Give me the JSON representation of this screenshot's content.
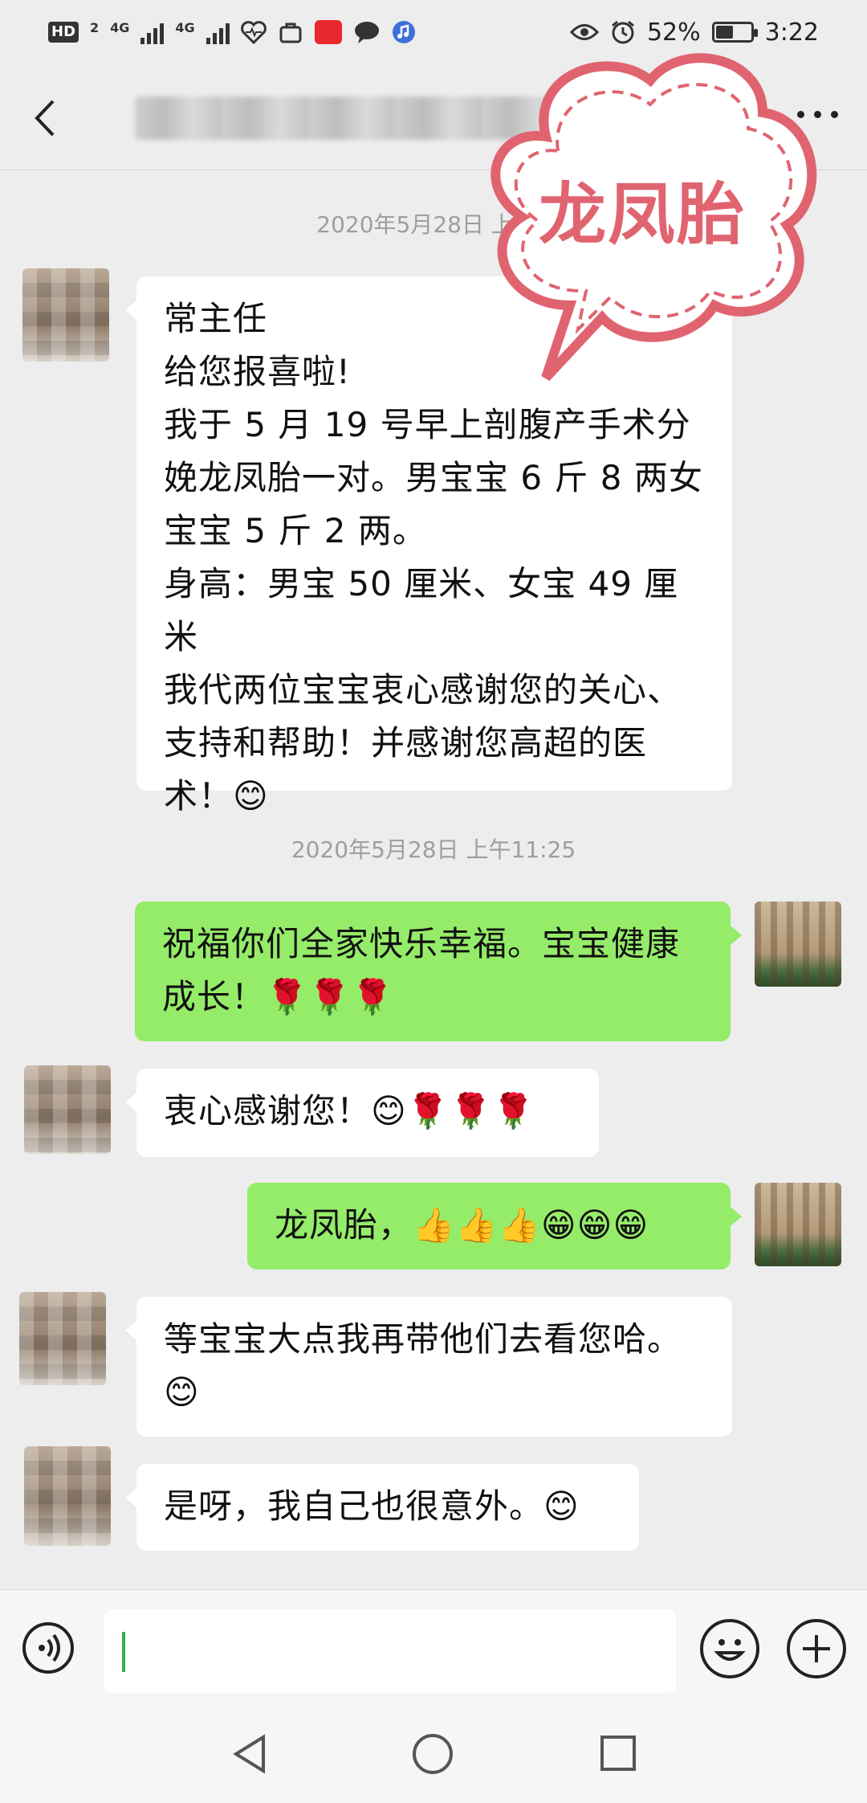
{
  "status_bar": {
    "left_badges": [
      "HD",
      "2"
    ],
    "network_1": "4G",
    "network_2": "4G",
    "battery_percent": "52%",
    "battery_level": 0.52,
    "time": "3:22",
    "icons": [
      "hd-icon",
      "signal-icon",
      "signal-icon",
      "heart-pulse-icon",
      "bag-icon",
      "huawei-app-icon",
      "message-icon",
      "music-icon",
      "eye-icon",
      "alarm-icon",
      "battery-icon"
    ]
  },
  "header": {
    "back_icon": "chevron-left-icon",
    "more_icon": "more-icon"
  },
  "stamp": {
    "text": "龙凤胎",
    "color": "#e06470"
  },
  "messages": [
    {
      "time": "2020年5月28日 上午1"
    },
    {
      "side": "in",
      "text": "常主任\n给您报喜啦!\n我于 5 月 19 号早上剖腹产手术分娩龙凤胎一对。男宝宝 6 斤 8 两女宝宝 5 斤 2 两。\n身高：男宝 50 厘米、女宝 49 厘米\n我代两位宝宝衷心感谢您的关心、支持和帮助！并感谢您高超的医术！😊"
    },
    {
      "time": "2020年5月28日 上午11:25"
    },
    {
      "side": "out",
      "text": "祝福你们全家快乐幸福。宝宝健康成长！🌹🌹🌹"
    },
    {
      "side": "in",
      "text": "衷心感谢您！😊🌹🌹🌹"
    },
    {
      "side": "out",
      "text": "龙凤胎，👍👍👍😁😁😁"
    },
    {
      "side": "in",
      "text": "等宝宝大点我再带他们去看您哈。😊"
    },
    {
      "side": "in",
      "text": "是呀，我自己也很意外。😊"
    }
  ],
  "input_bar": {
    "voice_icon": "voice-icon",
    "value": "",
    "emoji_icon": "emoji-icon",
    "plus_icon": "plus-icon"
  },
  "nav_bar": {
    "icons": [
      "nav-back-icon",
      "nav-home-icon",
      "nav-recent-icon"
    ]
  },
  "colors": {
    "background": "#ededed",
    "bubble_out": "#95ec69",
    "bubble_in": "#ffffff",
    "timestamp": "#9e9e9e"
  }
}
